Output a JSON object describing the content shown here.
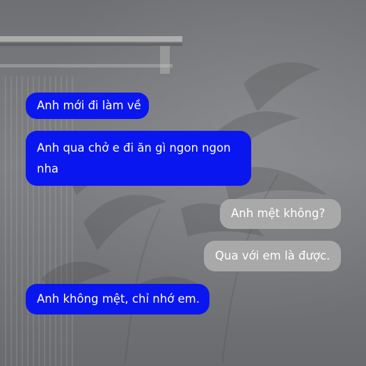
{
  "colors": {
    "sent_bubble": "#0a16f0",
    "received_bubble": "#a9a9aa",
    "bubble_text": "#ffffff"
  },
  "messages": [
    {
      "side": "left",
      "style": "sent",
      "text": "Anh mới đi làm về"
    },
    {
      "side": "left",
      "style": "sent",
      "text": "Anh qua chở e đi ăn gì ngon ngon nha"
    },
    {
      "side": "right",
      "style": "received",
      "text": "Anh mệt không?"
    },
    {
      "side": "right",
      "style": "received",
      "text": "Qua với em là được."
    },
    {
      "side": "left",
      "style": "sent",
      "text": "Anh không mệt, chỉ nhớ em."
    }
  ]
}
